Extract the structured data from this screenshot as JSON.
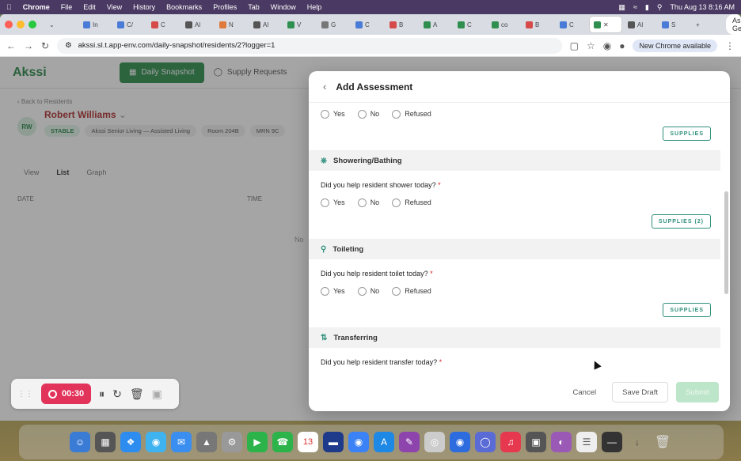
{
  "menubar": {
    "app": "Chrome",
    "items": [
      "File",
      "Edit",
      "View",
      "History",
      "Bookmarks",
      "Profiles",
      "Tab",
      "Window",
      "Help"
    ],
    "clock": "Thu Aug 13  8:16 AM"
  },
  "browser": {
    "tabs": [
      "In",
      "C/",
      "C",
      "Al",
      "N",
      "Al",
      "V",
      "G",
      "C",
      "B",
      "A",
      "C",
      "co",
      "B",
      "C",
      "",
      "Al",
      "S"
    ],
    "ask_gemini": "Ask Gemini",
    "url": "akssi.sl.t.app-env.com/daily-snapshot/residents/2?logger=1",
    "new_chrome": "New Chrome available"
  },
  "app": {
    "logo": "Akssi",
    "nav": {
      "daily_snapshot": "Daily Snapshot",
      "supply_requests": "Supply Requests"
    },
    "back": "Back to Residents",
    "resident_name": "Robert Williams",
    "initials": "RW",
    "status": "STABLE",
    "facility": "Akssi Senior Living — Assisted Living",
    "room": "Room 204B",
    "mrn": "MRN 9C",
    "view_label": "View",
    "view_list": "List",
    "view_graph": "Graph",
    "col_date": "DATE",
    "col_time": "TIME",
    "no_data": "No"
  },
  "modal": {
    "title": "Add Assessment",
    "options": {
      "yes": "Yes",
      "no": "No",
      "refused": "Refused"
    },
    "supplies": "SUPPLIES",
    "supplies_2": "SUPPLIES (2)",
    "sections": [
      {
        "title": "Showering/Bathing",
        "question": "Did you help resident shower today?"
      },
      {
        "title": "Toileting",
        "question": "Did you help resident toilet today?"
      },
      {
        "title": "Transferring",
        "question": "Did you help resident transfer today?"
      }
    ],
    "required_mark": "*",
    "cancel": "Cancel",
    "save_draft": "Save Draft",
    "submit": "Submit"
  },
  "recorder": {
    "time": "00:30"
  },
  "dock": {
    "calendar_day": "13"
  }
}
